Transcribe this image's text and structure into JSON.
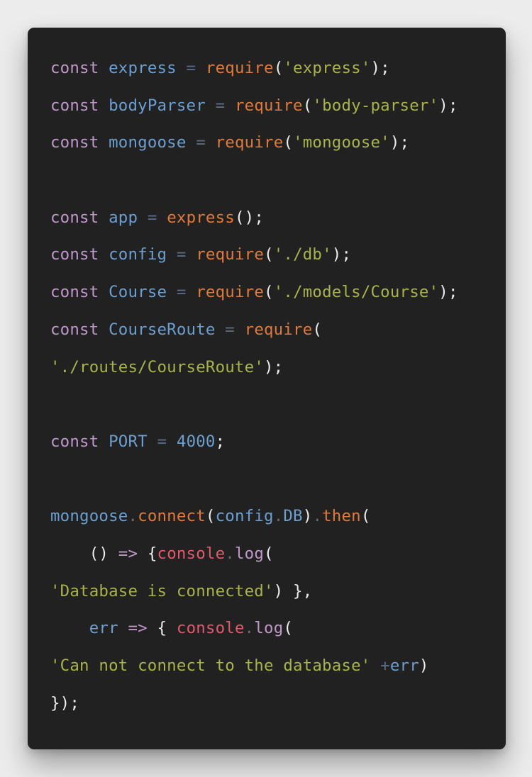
{
  "code_lines": [
    [
      [
        "kw",
        "const"
      ],
      [
        "pun",
        " "
      ],
      [
        "var",
        "express"
      ],
      [
        "pun",
        " "
      ],
      [
        "op",
        "="
      ],
      [
        "pun",
        " "
      ],
      [
        "fn",
        "require"
      ],
      [
        "pun",
        "("
      ],
      [
        "str",
        "'express'"
      ],
      [
        "pun",
        ");"
      ]
    ],
    [
      [
        "kw",
        "const"
      ],
      [
        "pun",
        " "
      ],
      [
        "var",
        "bodyParser"
      ],
      [
        "pun",
        " "
      ],
      [
        "op",
        "="
      ],
      [
        "pun",
        " "
      ],
      [
        "fn",
        "require"
      ],
      [
        "pun",
        "("
      ],
      [
        "str",
        "'body-parser'"
      ],
      [
        "pun",
        ");"
      ]
    ],
    [
      [
        "kw",
        "const"
      ],
      [
        "pun",
        " "
      ],
      [
        "var",
        "mongoose"
      ],
      [
        "pun",
        " "
      ],
      [
        "op",
        "="
      ],
      [
        "pun",
        " "
      ],
      [
        "fn",
        "require"
      ],
      [
        "pun",
        "("
      ],
      [
        "str",
        "'mongoose'"
      ],
      [
        "pun",
        ");"
      ]
    ],
    [],
    [
      [
        "kw",
        "const"
      ],
      [
        "pun",
        " "
      ],
      [
        "var",
        "app"
      ],
      [
        "pun",
        " "
      ],
      [
        "op",
        "="
      ],
      [
        "pun",
        " "
      ],
      [
        "fn",
        "express"
      ],
      [
        "pun",
        "();"
      ]
    ],
    [
      [
        "kw",
        "const"
      ],
      [
        "pun",
        " "
      ],
      [
        "var",
        "config"
      ],
      [
        "pun",
        " "
      ],
      [
        "op",
        "="
      ],
      [
        "pun",
        " "
      ],
      [
        "fn",
        "require"
      ],
      [
        "pun",
        "("
      ],
      [
        "str",
        "'./db'"
      ],
      [
        "pun",
        ");"
      ]
    ],
    [
      [
        "kw",
        "const"
      ],
      [
        "pun",
        " "
      ],
      [
        "var",
        "Course"
      ],
      [
        "pun",
        " "
      ],
      [
        "op",
        "="
      ],
      [
        "pun",
        " "
      ],
      [
        "fn",
        "require"
      ],
      [
        "pun",
        "("
      ],
      [
        "str",
        "'./models/Course'"
      ],
      [
        "pun",
        ");"
      ]
    ],
    [
      [
        "kw",
        "const"
      ],
      [
        "pun",
        " "
      ],
      [
        "var",
        "CourseRoute"
      ],
      [
        "pun",
        " "
      ],
      [
        "op",
        "="
      ],
      [
        "pun",
        " "
      ],
      [
        "fn",
        "require"
      ],
      [
        "pun",
        "("
      ]
    ],
    [
      [
        "str",
        "'./routes/CourseRoute'"
      ],
      [
        "pun",
        ");"
      ]
    ],
    [],
    [
      [
        "kw",
        "const"
      ],
      [
        "pun",
        " "
      ],
      [
        "var",
        "PORT"
      ],
      [
        "pun",
        " "
      ],
      [
        "op",
        "="
      ],
      [
        "pun",
        " "
      ],
      [
        "num",
        "4000"
      ],
      [
        "pun",
        ";"
      ]
    ],
    [],
    [
      [
        "var",
        "mongoose"
      ],
      [
        "dot",
        "."
      ],
      [
        "fn",
        "connect"
      ],
      [
        "pun",
        "("
      ],
      [
        "var",
        "config"
      ],
      [
        "dot",
        "."
      ],
      [
        "var",
        "DB"
      ],
      [
        "pun",
        ")"
      ],
      [
        "dot",
        "."
      ],
      [
        "fn",
        "then"
      ],
      [
        "pun",
        "("
      ]
    ],
    [
      [
        "pun",
        "    () "
      ],
      [
        "arrow",
        "=>"
      ],
      [
        "pun",
        " {"
      ],
      [
        "obj",
        "console"
      ],
      [
        "dot",
        "."
      ],
      [
        "meth",
        "log"
      ],
      [
        "pun",
        "("
      ]
    ],
    [
      [
        "str",
        "'Database is connected'"
      ],
      [
        "pun",
        ") },"
      ]
    ],
    [
      [
        "pun",
        "    "
      ],
      [
        "var",
        "err"
      ],
      [
        "pun",
        " "
      ],
      [
        "arrow",
        "=>"
      ],
      [
        "pun",
        " { "
      ],
      [
        "obj",
        "console"
      ],
      [
        "dot",
        "."
      ],
      [
        "meth",
        "log"
      ],
      [
        "pun",
        "("
      ]
    ],
    [
      [
        "str",
        "'Can not connect to the database'"
      ],
      [
        "pun",
        " "
      ],
      [
        "op",
        "+"
      ],
      [
        "var",
        "err"
      ],
      [
        "pun",
        ")"
      ]
    ],
    [
      [
        "pun",
        "});"
      ]
    ]
  ]
}
